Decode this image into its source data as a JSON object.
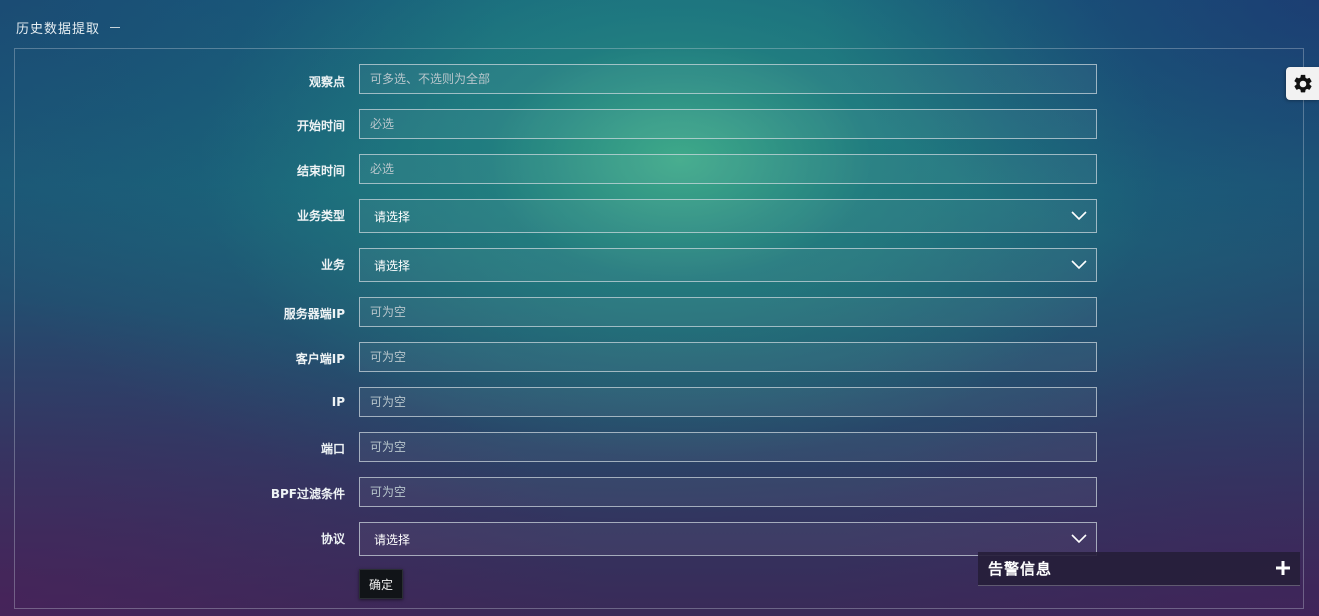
{
  "header": {
    "title": "历史数据提取",
    "collapse_icon": "minus-icon"
  },
  "form": {
    "observation_point": {
      "label": "观察点",
      "placeholder": "可多选、不选则为全部"
    },
    "start_time": {
      "label": "开始时间",
      "placeholder": "必选"
    },
    "end_time": {
      "label": "结束时间",
      "placeholder": "必选"
    },
    "business_type": {
      "label": "业务类型",
      "value": "请选择"
    },
    "business": {
      "label": "业务",
      "value": "请选择"
    },
    "server_ip": {
      "label": "服务器端IP",
      "placeholder": "可为空"
    },
    "client_ip": {
      "label": "客户端IP",
      "placeholder": "可为空"
    },
    "ip": {
      "label": "IP",
      "placeholder": "可为空"
    },
    "port": {
      "label": "端口",
      "placeholder": "可为空"
    },
    "bpf_filter": {
      "label": "BPF过滤条件",
      "placeholder": "可为空"
    },
    "protocol": {
      "label": "协议",
      "value": "请选择"
    },
    "submit_label": "确定"
  },
  "settings": {
    "icon": "gear-icon"
  },
  "alert_panel": {
    "title": "告警信息",
    "expand_icon": "plus-icon"
  },
  "colors": {
    "panel_border": "#c8d2dc",
    "button_bg": "#111418",
    "alert_bg": "#261e3a"
  }
}
